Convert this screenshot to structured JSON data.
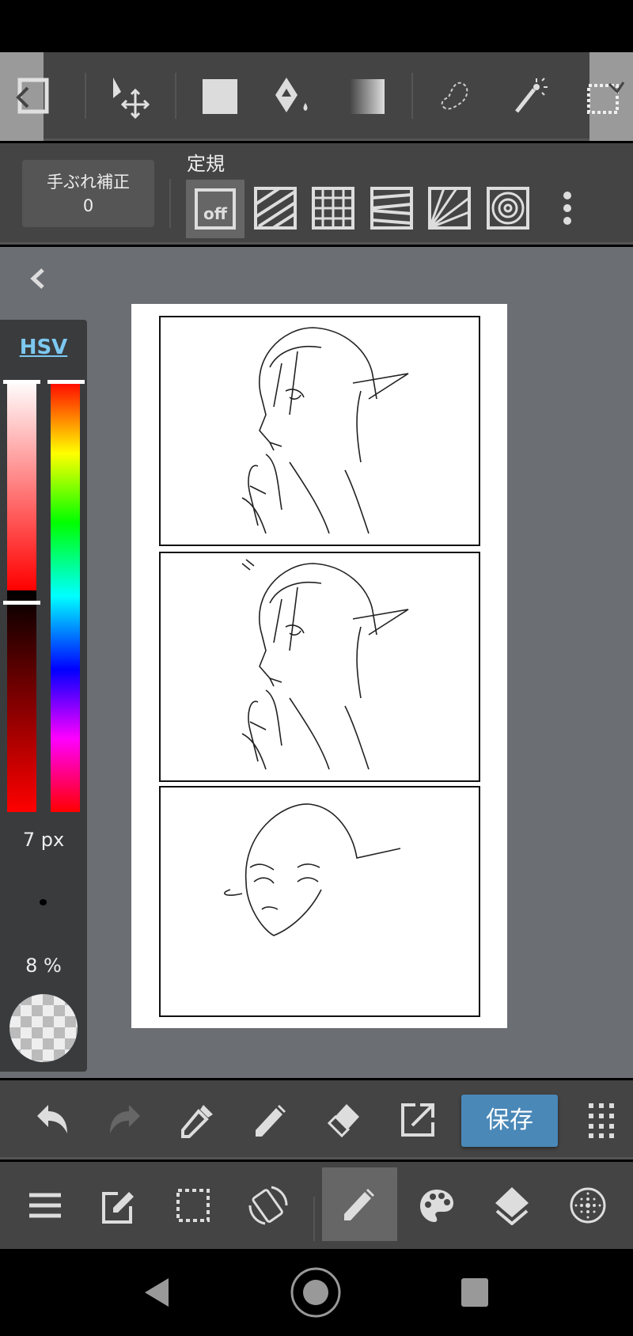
{
  "top_toolbar": {
    "tools": [
      "scroll-left",
      "select-layer",
      "move",
      "fill-rect",
      "bucket",
      "gradient",
      "lasso",
      "magic-wand",
      "select-pen",
      "scroll-right"
    ]
  },
  "second_toolbar": {
    "stabilizer_label": "手ぶれ補正",
    "stabilizer_value": "0",
    "ruler_label": "定規",
    "ruler_off_label": "off",
    "rulers": [
      "off",
      "parallel",
      "grid",
      "perspective",
      "radial",
      "concentric"
    ]
  },
  "color_panel": {
    "mode_label": "HSV",
    "brush_size": "7 px",
    "opacity": "8 %",
    "saturation": 1.0,
    "value": 1.0,
    "hue": 0,
    "color": "#ff0000"
  },
  "bottom_toolbar": {
    "save_label": "保存",
    "accent": "#4a88b8"
  },
  "canvas": {
    "panels": 3
  }
}
